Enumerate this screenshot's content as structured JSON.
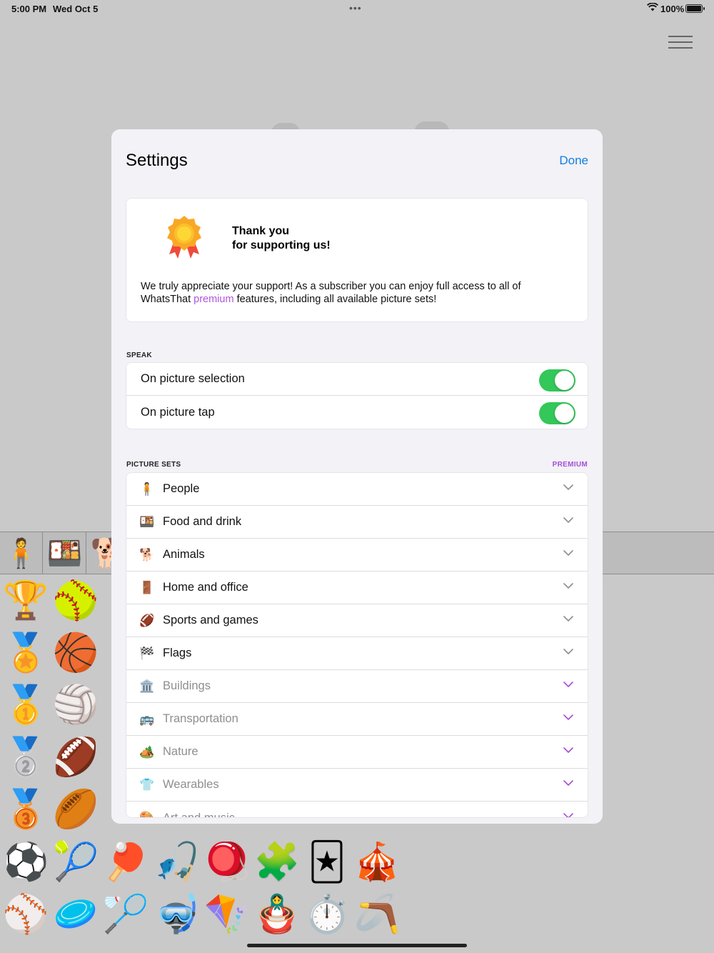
{
  "status_bar": {
    "time": "5:00 PM",
    "date": "Wed Oct 5",
    "dots": "•••",
    "battery": "100%"
  },
  "background": {
    "tabs": [
      "🧍",
      "🍱",
      "🐕"
    ],
    "grid": [
      "🏆",
      "🥎",
      "🎳",
      "🏅",
      "🏀",
      "🏐",
      "🥇",
      "🏐",
      "🥈",
      "🏈",
      "🥉",
      "🏉",
      "⚽",
      "🎾",
      "🏓",
      "🎣",
      "🪀",
      "🧩",
      "🃏",
      "🎪",
      "⚾",
      "🥏",
      "🏸",
      "🤿",
      "🪁",
      "🪆",
      "⏱️",
      "🪃"
    ]
  },
  "modal": {
    "title": "Settings",
    "done_label": "Done",
    "support": {
      "title_line1": "Thank you",
      "title_line2": "for supporting us!",
      "text_before": "We truly appreciate your support! As a subscriber you can enjoy full access to all of WhatsThat ",
      "premium_word": "premium",
      "text_after": " features, including all available picture sets!"
    },
    "speak": {
      "header": "SPEAK",
      "rows": [
        {
          "label": "On picture selection",
          "on": true
        },
        {
          "label": "On picture tap",
          "on": true
        }
      ]
    },
    "picture_sets": {
      "header": "PICTURE SETS",
      "premium_label": "PREMIUM",
      "items": [
        {
          "icon": "🧍",
          "label": "People",
          "locked": false
        },
        {
          "icon": "🍱",
          "label": "Food and drink",
          "locked": false
        },
        {
          "icon": "🐕",
          "label": "Animals",
          "locked": false
        },
        {
          "icon": "🚪",
          "label": "Home and office",
          "locked": false
        },
        {
          "icon": "🏈",
          "label": "Sports and games",
          "locked": false
        },
        {
          "icon": "🏁",
          "label": "Flags",
          "locked": false
        },
        {
          "icon": "🏛️",
          "label": "Buildings",
          "locked": true
        },
        {
          "icon": "🚌",
          "label": "Transportation",
          "locked": true
        },
        {
          "icon": "🏕️",
          "label": "Nature",
          "locked": true
        },
        {
          "icon": "👕",
          "label": "Wearables",
          "locked": true
        },
        {
          "icon": "🎨",
          "label": "Art and music",
          "locked": true
        }
      ]
    }
  },
  "colors": {
    "accent_blue": "#147ee0",
    "premium_purple": "#a84fd6",
    "toggle_green": "#34c759",
    "chevron_gray": "#8e8e93"
  }
}
